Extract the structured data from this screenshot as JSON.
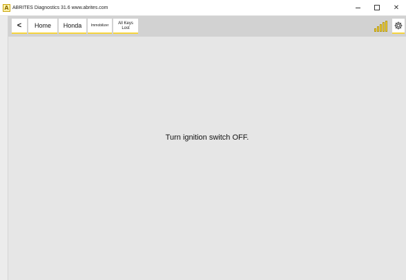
{
  "window": {
    "title": "ABRITES Diagnostics 31.6  www.abrites.com",
    "logo_letter": "A",
    "minimize_icon": "minimize-icon",
    "maximize_icon": "maximize-icon",
    "close_label": "✕"
  },
  "toolbar": {
    "back_label": "<",
    "breadcrumbs": {
      "home": "Home",
      "honda": "Honda",
      "immobilizer": "Immobilizer",
      "all_keys_line1": "All Keys",
      "all_keys_line2": "Lost"
    },
    "signal_icon": "signal-strength-icon",
    "settings_icon": "gear-icon"
  },
  "main": {
    "message": "Turn ignition switch OFF."
  },
  "colors": {
    "accent": "#f5d33c",
    "toolbar_bg": "#d2d2d2",
    "content_bg": "#e6e6e6"
  }
}
